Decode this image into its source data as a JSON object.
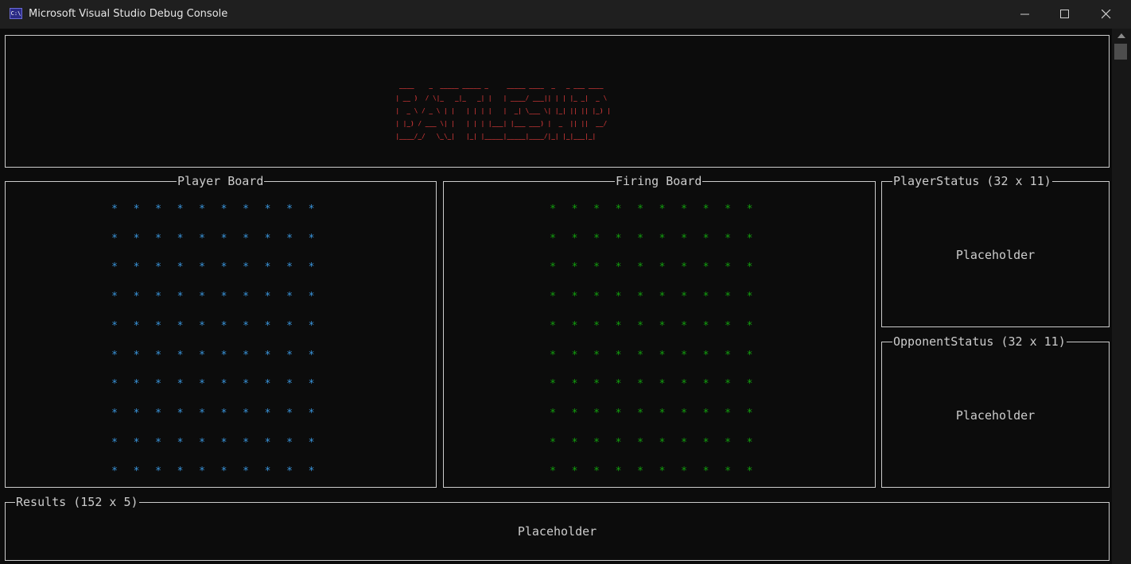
{
  "window": {
    "title": "Microsoft Visual Studio Debug Console",
    "icon": "C:\\",
    "icon_name": "console-app-icon",
    "controls": [
      "minimize-icon",
      "maximize-icon",
      "close-icon"
    ]
  },
  "banner": {
    "lines": [
      " ____    _  _____ _____ _     _____ ____  _   _ ___ ____  ",
      "| __ )  / \\|_   _|_   _| |   | ____/ ___|| | | |_ _|  _ \\ ",
      "|  _ \\ / _ \\ | |   | | | |   |  _| \\___ \\| |_| || || |_) |",
      "| |_) / ___ \\| |   | | | |___| |___ ___) |  _  || ||  __/ ",
      "|____/_/   \\_\\_|   |_| |_____|_____|____/|_| |_|___|_|    "
    ],
    "color": "#c03434"
  },
  "player_board": {
    "title": "Player Board",
    "rows": 10,
    "cols": 10,
    "symbol": "*",
    "color": "#3a96dd"
  },
  "firing_board": {
    "title": "Firing Board",
    "rows": 10,
    "cols": 10,
    "symbol": "*",
    "color": "#13a10e"
  },
  "player_status": {
    "title": "PlayerStatus (32 x 11)",
    "placeholder": "Placeholder"
  },
  "opponent_status": {
    "title": "OpponentStatus (32 x 11)",
    "placeholder": "Placeholder"
  },
  "results": {
    "title": "Results (152 x 5)",
    "placeholder": "Placeholder"
  },
  "colors": {
    "background": "#0c0c0c",
    "border": "#cccccc",
    "text": "#cccccc"
  }
}
